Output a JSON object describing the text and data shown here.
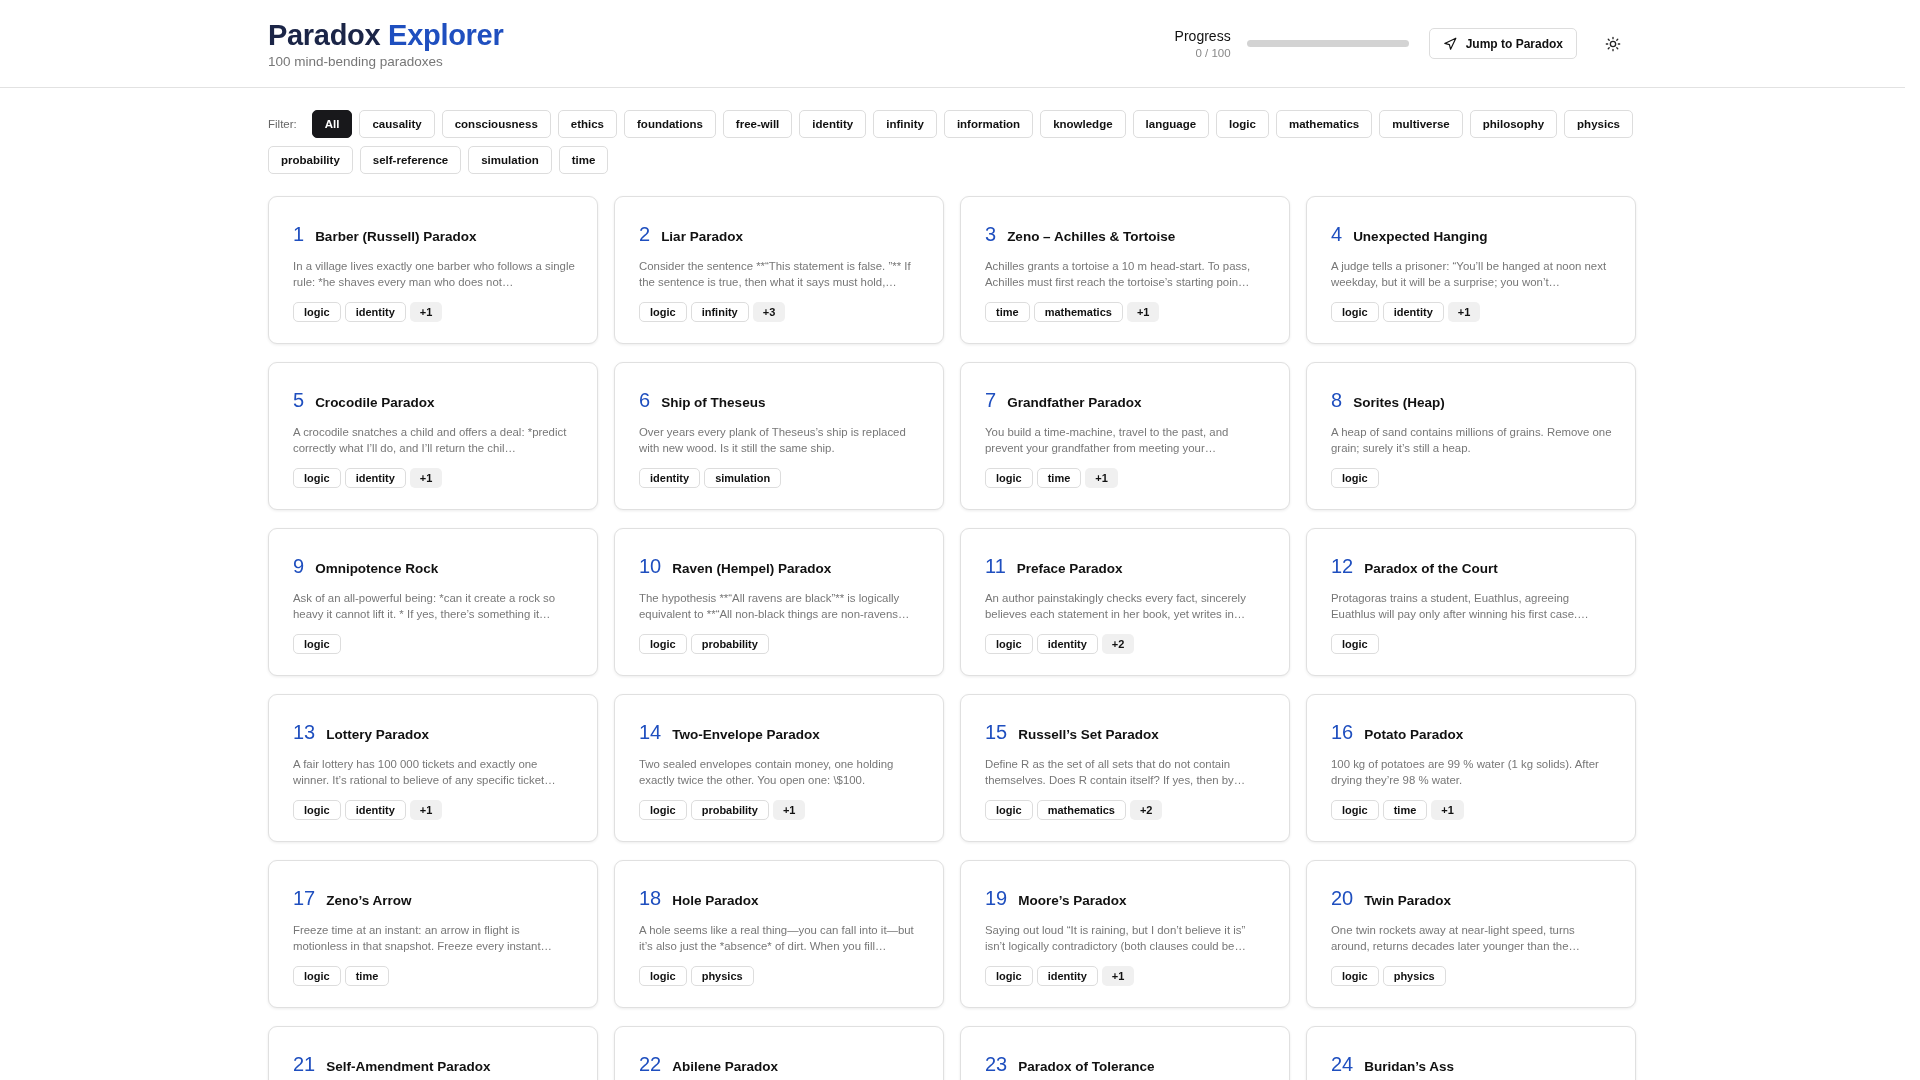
{
  "header": {
    "title_main": "Paradox",
    "title_accent": "Explorer",
    "subtitle": "100 mind-bending paradoxes",
    "progress": {
      "label": "Progress",
      "count": "0 / 100",
      "level": 0
    },
    "jump_button": "Jump to Paradox"
  },
  "filter": {
    "label": "Filter:",
    "chips": [
      {
        "label": "All",
        "selected": true
      },
      {
        "label": "causality",
        "selected": false
      },
      {
        "label": "consciousness",
        "selected": false
      },
      {
        "label": "ethics",
        "selected": false
      },
      {
        "label": "foundations",
        "selected": false
      },
      {
        "label": "free-will",
        "selected": false
      },
      {
        "label": "identity",
        "selected": false
      },
      {
        "label": "infinity",
        "selected": false
      },
      {
        "label": "information",
        "selected": false
      },
      {
        "label": "knowledge",
        "selected": false
      },
      {
        "label": "language",
        "selected": false
      },
      {
        "label": "logic",
        "selected": false
      },
      {
        "label": "mathematics",
        "selected": false
      },
      {
        "label": "multiverse",
        "selected": false
      },
      {
        "label": "philosophy",
        "selected": false
      },
      {
        "label": "physics",
        "selected": false
      },
      {
        "label": "probability",
        "selected": false
      },
      {
        "label": "self-reference",
        "selected": false
      },
      {
        "label": "simulation",
        "selected": false
      },
      {
        "label": "time",
        "selected": false
      }
    ]
  },
  "cards": [
    {
      "number": "1",
      "title": "Barber (Russell) Paradox",
      "description": "In a village lives exactly one barber who follows a single rule: *he shaves every man who does not…",
      "tags": [
        "logic",
        "identity"
      ],
      "more": "+1"
    },
    {
      "number": "2",
      "title": "Liar Paradox",
      "description": "Consider the sentence **“This statement is false. ”** If the sentence is true, then what it says must hold,…",
      "tags": [
        "logic",
        "infinity"
      ],
      "more": "+3"
    },
    {
      "number": "3",
      "title": "Zeno – Achilles & Tortoise",
      "description": "Achilles grants a tortoise a 10 m head-start. To pass, Achilles must first reach the tortoise’s starting poin…",
      "tags": [
        "time",
        "mathematics"
      ],
      "more": "+1"
    },
    {
      "number": "4",
      "title": "Unexpected Hanging",
      "description": "A judge tells a prisoner: “You’ll be hanged at noon next weekday, but it will be a surprise; you won’t…",
      "tags": [
        "logic",
        "identity"
      ],
      "more": "+1"
    },
    {
      "number": "5",
      "title": "Crocodile Paradox",
      "description": "A crocodile snatches a child and offers a deal: *predict correctly what I’ll do, and I’ll return the chil…",
      "tags": [
        "logic",
        "identity"
      ],
      "more": "+1"
    },
    {
      "number": "6",
      "title": "Ship of Theseus",
      "description": "Over years every plank of Theseus’s ship is replaced with new wood. Is it still the same ship.",
      "tags": [
        "identity",
        "simulation"
      ]
    },
    {
      "number": "7",
      "title": "Grandfather Paradox",
      "description": "You build a time-machine, travel to the past, and prevent your grandfather from meeting your…",
      "tags": [
        "logic",
        "time"
      ],
      "more": "+1"
    },
    {
      "number": "8",
      "title": "Sorites (Heap)",
      "description": "A heap of sand contains millions of grains. Remove one grain; surely it’s still a heap.",
      "tags": [
        "logic"
      ]
    },
    {
      "number": "9",
      "title": "Omnipotence Rock",
      "description": "Ask of an all-powerful being: *can it create a rock so heavy it cannot lift it. * If yes, there’s something it…",
      "tags": [
        "logic"
      ]
    },
    {
      "number": "10",
      "title": "Raven (Hempel) Paradox",
      "description": "The hypothesis **“All ravens are black”** is logically equivalent to **“All non-black things are non-ravens…",
      "tags": [
        "logic",
        "probability"
      ]
    },
    {
      "number": "11",
      "title": "Preface Paradox",
      "description": "An author painstakingly checks every fact, sincerely believes each statement in her book, yet writes in…",
      "tags": [
        "logic",
        "identity"
      ],
      "more": "+2"
    },
    {
      "number": "12",
      "title": "Paradox of the Court",
      "description": "Protagoras trains a student, Euathlus, agreeing Euathlus will pay only after winning his first case.…",
      "tags": [
        "logic"
      ]
    },
    {
      "number": "13",
      "title": "Lottery Paradox",
      "description": "A fair lottery has 100 000 tickets and exactly one winner. It’s rational to believe of any specific ticket…",
      "tags": [
        "logic",
        "identity"
      ],
      "more": "+1"
    },
    {
      "number": "14",
      "title": "Two-Envelope Paradox",
      "description": "Two sealed envelopes contain money, one holding exactly twice the other. You open one: \\$100.",
      "tags": [
        "logic",
        "probability"
      ],
      "more": "+1"
    },
    {
      "number": "15",
      "title": "Russell’s Set Paradox",
      "description": "Define R as the set of all sets that do not contain themselves. Does R contain itself? If yes, then by…",
      "tags": [
        "logic",
        "mathematics"
      ],
      "more": "+2"
    },
    {
      "number": "16",
      "title": "Potato Paradox",
      "description": "100 kg of potatoes are 99 % water (1 kg solids). After drying they’re 98 % water.",
      "tags": [
        "logic",
        "time"
      ],
      "more": "+1"
    },
    {
      "number": "17",
      "title": "Zeno’s Arrow",
      "description": "Freeze time at an instant: an arrow in flight is motionless in that snapshot. Freeze every instant…",
      "tags": [
        "logic",
        "time"
      ]
    },
    {
      "number": "18",
      "title": "Hole Paradox",
      "description": "A hole seems like a real thing—you can fall into it—but it’s also just the *absence* of dirt. When you fill…",
      "tags": [
        "logic",
        "physics"
      ]
    },
    {
      "number": "19",
      "title": "Moore’s Paradox",
      "description": "Saying out loud “It is raining, but I don’t believe it is” isn’t logically contradictory (both clauses could be…",
      "tags": [
        "logic",
        "identity"
      ],
      "more": "+1"
    },
    {
      "number": "20",
      "title": "Twin Paradox",
      "description": "One twin rockets away at near-light speed, turns around, returns decades later younger than the…",
      "tags": [
        "logic",
        "physics"
      ]
    },
    {
      "number": "21",
      "title": "Self-Amendment Paradox"
    },
    {
      "number": "22",
      "title": "Abilene Paradox"
    },
    {
      "number": "23",
      "title": "Paradox of Tolerance"
    },
    {
      "number": "24",
      "title": "Buridan’s Ass"
    }
  ]
}
